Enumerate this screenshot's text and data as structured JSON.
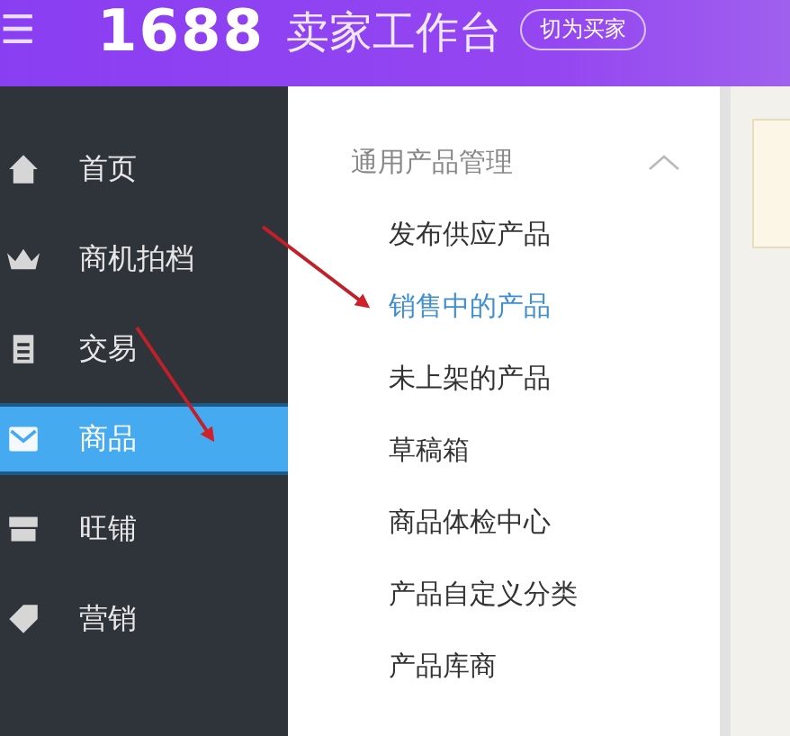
{
  "header": {
    "menu_icon": "☰",
    "logo": "1688",
    "title": "卖家工作台",
    "switch_button": "切为买家"
  },
  "sidebar": {
    "items": [
      {
        "label": "首页",
        "selected": false
      },
      {
        "label": "商机拍档",
        "selected": false
      },
      {
        "label": "交易",
        "selected": false
      },
      {
        "label": "商品",
        "selected": true
      },
      {
        "label": "旺铺",
        "selected": false
      },
      {
        "label": "营销",
        "selected": false
      }
    ]
  },
  "submenu": {
    "title": "通用产品管理",
    "expanded": true,
    "items": [
      {
        "label": "发布供应产品",
        "selected": false
      },
      {
        "label": "销售中的产品",
        "selected": true
      },
      {
        "label": "未上架的产品",
        "selected": false
      },
      {
        "label": "草稿箱",
        "selected": false
      },
      {
        "label": "商品体检中心",
        "selected": false
      },
      {
        "label": "产品自定义分类",
        "selected": false
      },
      {
        "label": "产品库商",
        "selected": false
      }
    ]
  }
}
